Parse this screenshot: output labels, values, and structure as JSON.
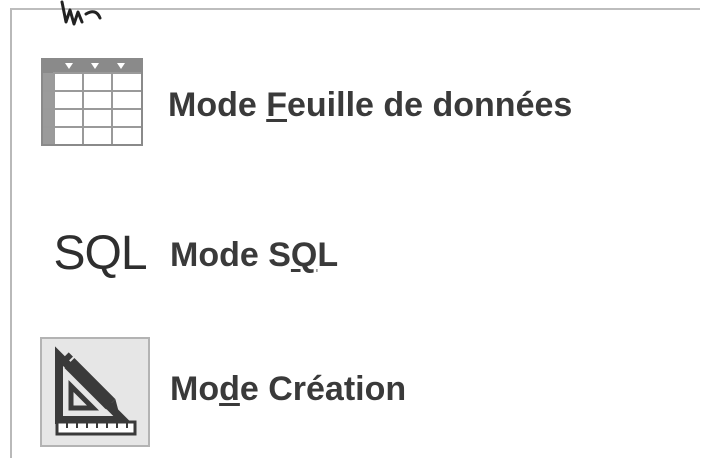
{
  "menu": {
    "items": [
      {
        "label_before": "Mode ",
        "accel": "F",
        "label_after": "euille de données",
        "icon": "datasheet-grid-icon"
      },
      {
        "icon_text": "SQL",
        "label_before": "Mode S",
        "accel": "Q",
        "label_after": "L",
        "icon": "sql-text-icon"
      },
      {
        "label_before": "Mo",
        "accel": "d",
        "label_after": "e Création",
        "icon": "design-ruler-pencil-icon"
      }
    ]
  },
  "colors": {
    "text": "#3a3a3a",
    "grid_header": "#8a8a8a",
    "grid_line": "#9a9a9a",
    "design_bg": "#e6e6e6"
  }
}
